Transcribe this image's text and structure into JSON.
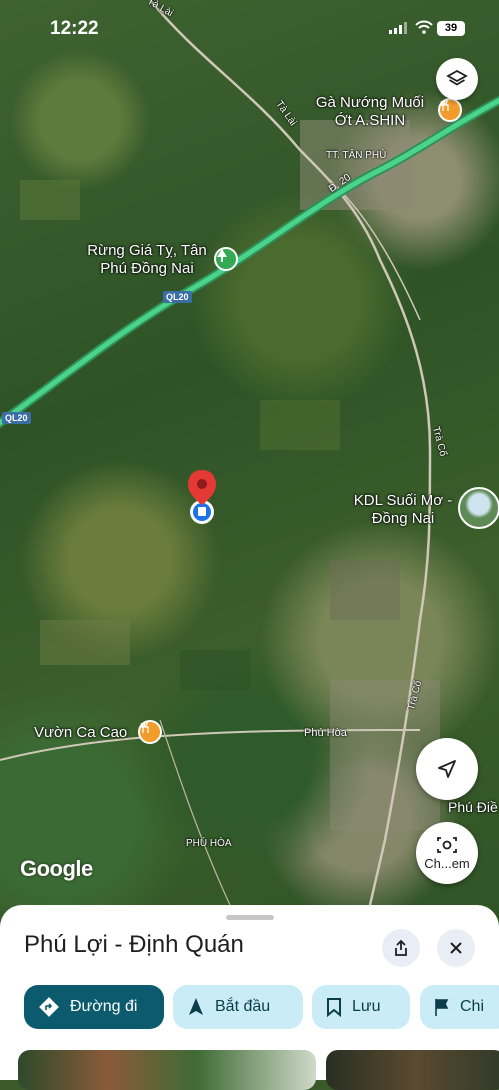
{
  "status_bar": {
    "time": "12:22",
    "battery": "39"
  },
  "map": {
    "labels": {
      "ga_nuong": "Gà Nướng Muối Ớt A.SHIN",
      "rung_gia_ty": "Rừng Giá Tỵ, Tân Phú Đồng Nai",
      "kdl_suoi_mo": "KDL Suối Mơ - Đồng Nai",
      "vuon_ca_cao": "Vườn Ca Cao",
      "phu_dien": "Phú Điề",
      "tt_tan_phu": "TT. TÂN PHÚ",
      "phu_hoa_upper": "PHÚ HÒA"
    },
    "roads": {
      "ta_lai_top": "Tà Lài",
      "ta_lai": "Tà Lài",
      "d20": "Đ. 20",
      "ql20_a": "QL20",
      "ql20_b": "QL20",
      "tra_co_a": "Trà Cổ",
      "tra_co_b": "Trà Cổ",
      "phu_hoa": "Phú Hòa"
    },
    "attribution": "Google",
    "street_view_label": "Ch...em"
  },
  "sheet": {
    "title": "Phú Lợi - Định Quán",
    "actions": [
      {
        "label": "Đường đi"
      },
      {
        "label": "Bắt đầu"
      },
      {
        "label": "Lưu"
      },
      {
        "label": "Chi"
      }
    ]
  },
  "colors": {
    "route": "#49d48a",
    "primary_chip": "#0b5a6e",
    "secondary_chip": "#c9ecf7",
    "pin": "#e53935"
  }
}
